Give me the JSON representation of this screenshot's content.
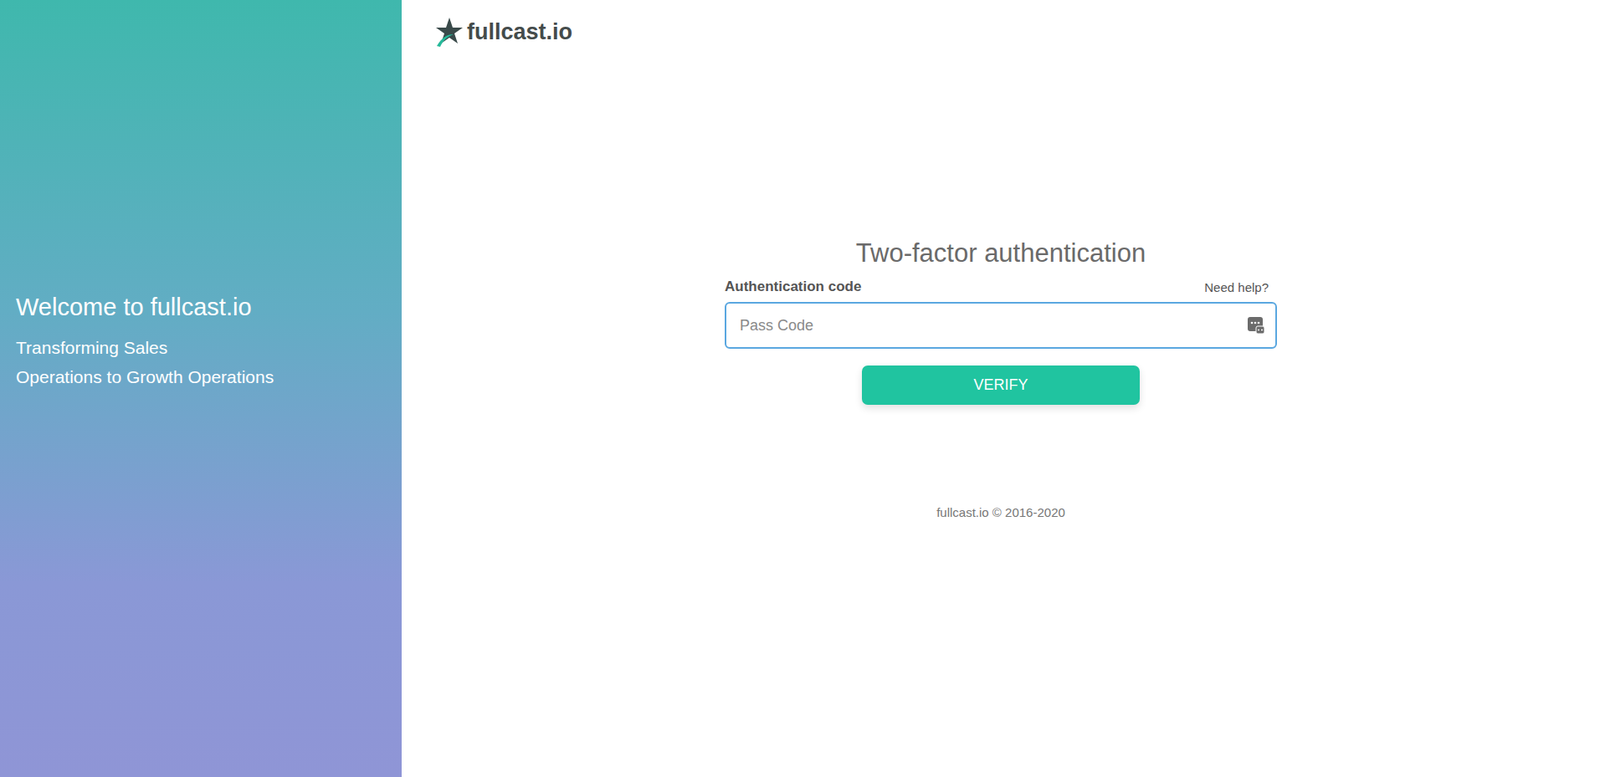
{
  "brand": {
    "logo_text": "fullcast.io"
  },
  "welcome": {
    "title": "Welcome to fullcast.io",
    "subtitle_lines": [
      "Transforming Sales",
      "Operations to Growth Operations"
    ]
  },
  "form": {
    "title": "Two-factor authentication",
    "label": "Authentication code",
    "help_link": "Need help?",
    "placeholder": "Pass Code",
    "button": "VERIFY"
  },
  "footer": "fullcast.io © 2016-2020"
}
